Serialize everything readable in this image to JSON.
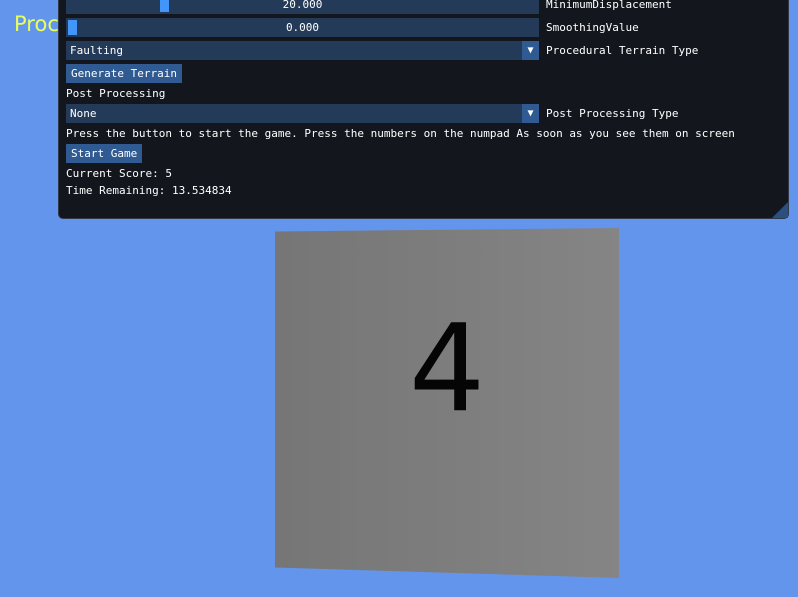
{
  "background": {
    "title": "Proc",
    "title_color": "#e8ff5a",
    "color": "#6495ed"
  },
  "panel": {
    "minimum_displacement": {
      "value": "20.000",
      "label": "MinimumDisplacement",
      "fraction": 0.2
    },
    "smoothing_value": {
      "value": "0.000",
      "label": "SmoothingValue",
      "fraction": 0.0
    },
    "terrain_type": {
      "selected": "Faulting",
      "label": "Procedural Terrain Type"
    },
    "generate_button": "Generate Terrain",
    "post_processing_header": "Post Processing",
    "post_processing_type": {
      "selected": "None",
      "label": "Post Processing Type"
    },
    "instructions": "Press the button to start the game. Press the numbers on the numpad As soon as you see them on screen",
    "start_button": "Start Game",
    "current_score": "Current Score: 5",
    "time_remaining": "Time Remaining: 13.534834"
  },
  "scene": {
    "digit": "4"
  },
  "icons": {
    "combo_arrow": "triangle-down-icon",
    "resize": "resize-grip-icon"
  }
}
